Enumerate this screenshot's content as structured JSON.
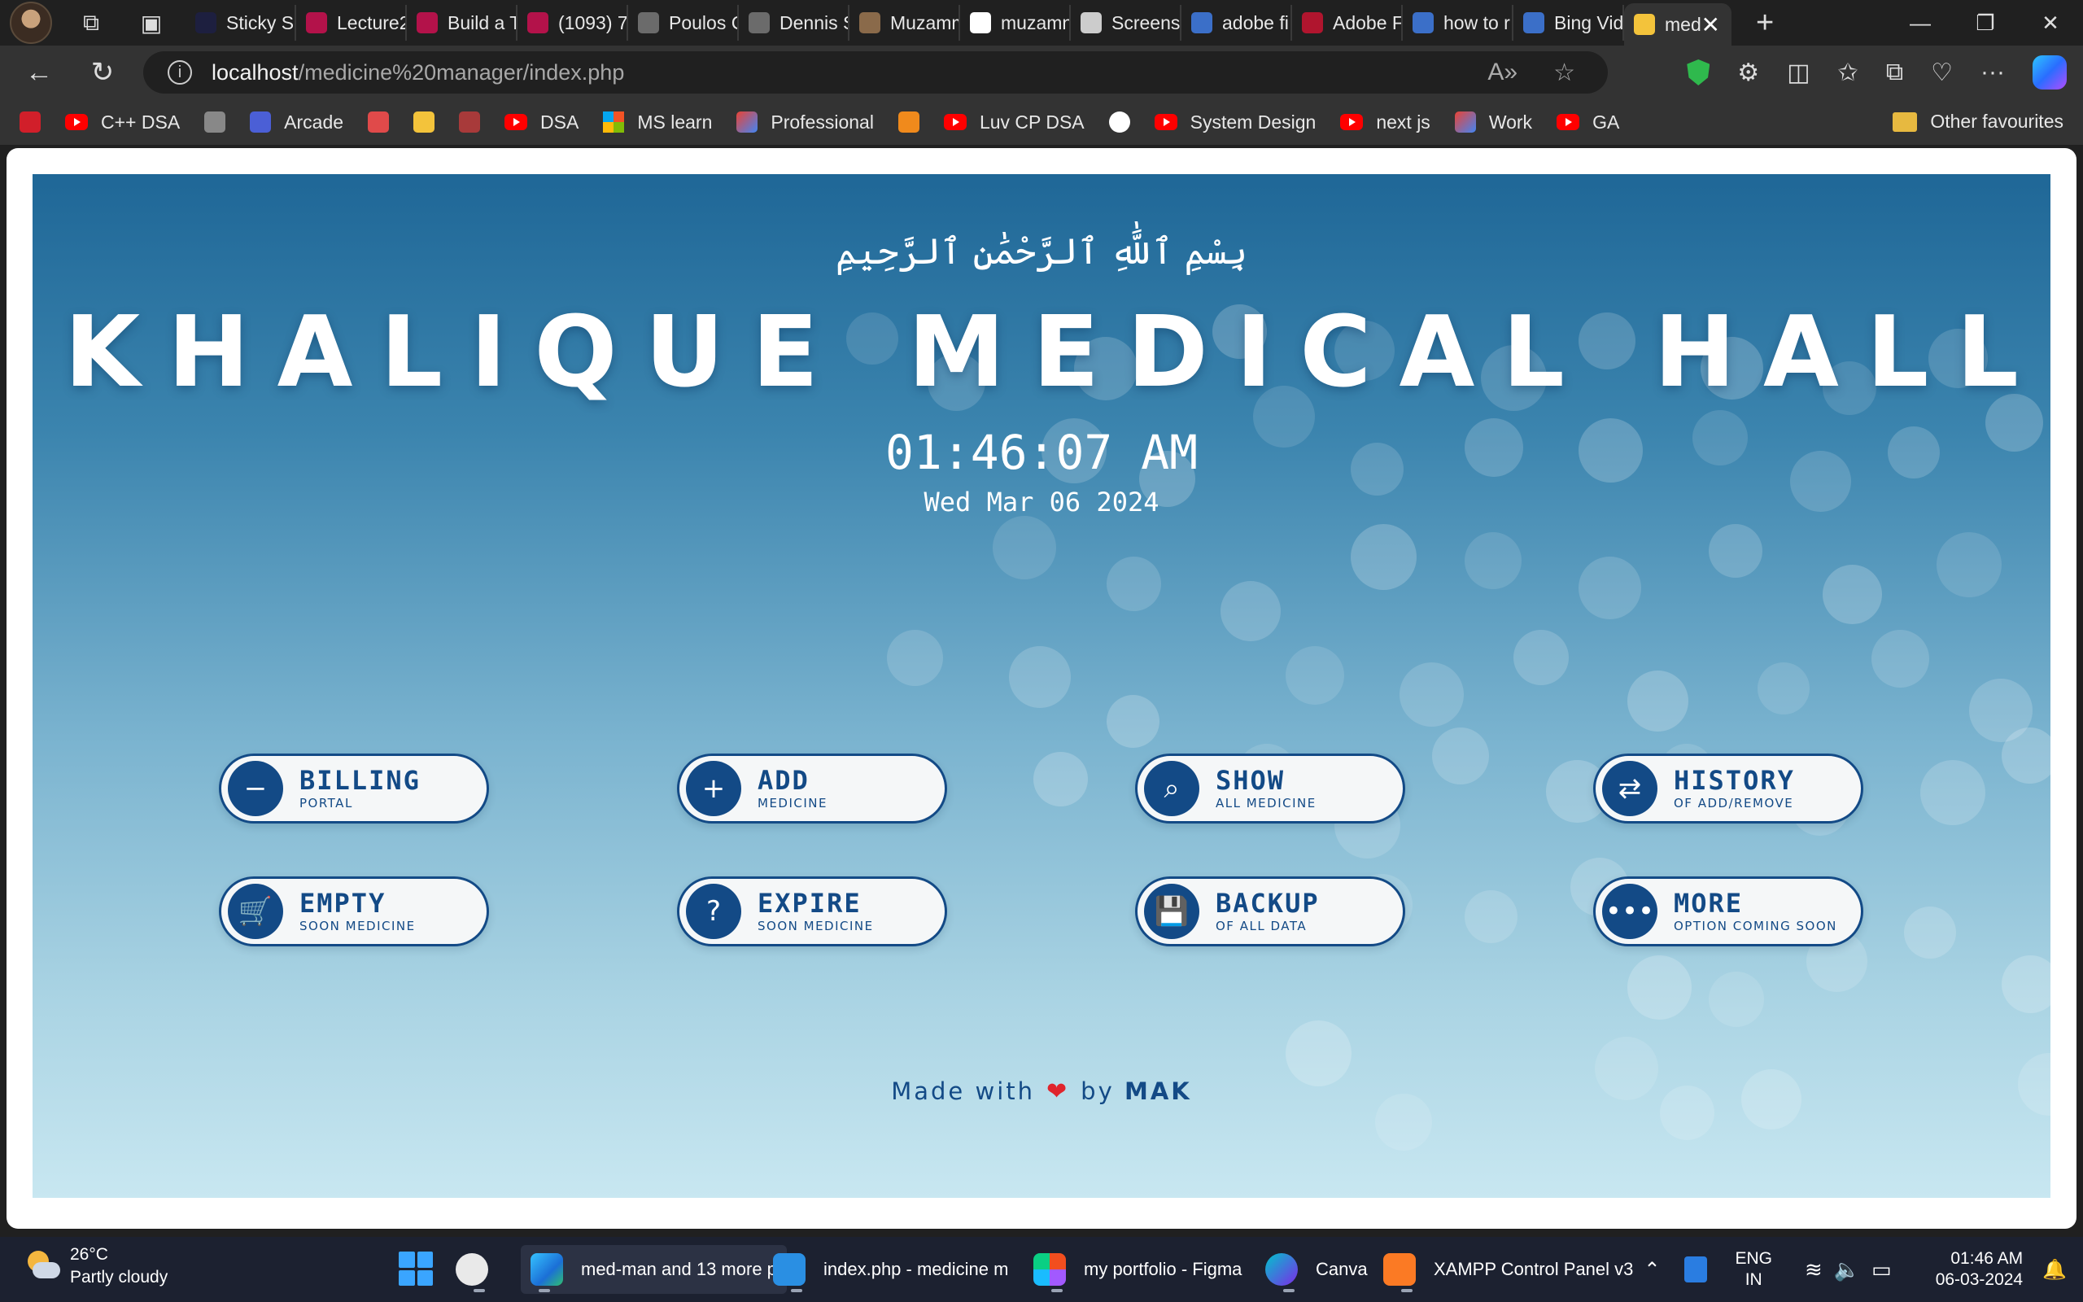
{
  "browser": {
    "tabs": [
      {
        "title": "Sticky Sc",
        "fav_color": "#1d1f3f"
      },
      {
        "title": "Lecture2",
        "fav_color": "#b3124a"
      },
      {
        "title": "Build a T",
        "fav_color": "#b3124a"
      },
      {
        "title": "(1093) 7",
        "fav_color": "#b3124a"
      },
      {
        "title": "Poulos C",
        "fav_color": "#6b6b6b"
      },
      {
        "title": "Dennis S",
        "fav_color": "#6b6b6b"
      },
      {
        "title": "Muzamm",
        "fav_color": "#8a6a4a"
      },
      {
        "title": "muzamn",
        "fav_color": "#ffffff"
      },
      {
        "title": "Screens",
        "fav_color": "#cccccc"
      },
      {
        "title": "adobe fi",
        "fav_color": "#3b6fc8"
      },
      {
        "title": "Adobe F",
        "fav_color": "#b0152e"
      },
      {
        "title": "how to r",
        "fav_color": "#3b6fc8"
      },
      {
        "title": "Bing Vid",
        "fav_color": "#3b6fc8"
      }
    ],
    "active_tab": {
      "title": "med",
      "close": "✕"
    },
    "new_tab": "+",
    "window_controls": {
      "minimize": "—",
      "restore": "❐",
      "close": "✕"
    },
    "back": "←",
    "refresh": "↻",
    "url_host": "localhost",
    "url_path": "/medicine%20manager/index.php",
    "bookmarks": [
      {
        "label": "",
        "kind": "sl"
      },
      {
        "label": "C++ DSA",
        "kind": "yt"
      },
      {
        "label": "",
        "kind": "icon",
        "color": "#888"
      },
      {
        "label": "Arcade",
        "kind": "icon",
        "color": "#4b5fd6"
      },
      {
        "label": "",
        "kind": "icon",
        "color": "#e04a4a"
      },
      {
        "label": "",
        "kind": "icon",
        "color": "#f3c33b"
      },
      {
        "label": "",
        "kind": "icon",
        "color": "#a83a3a"
      },
      {
        "label": "DSA",
        "kind": "yt"
      },
      {
        "label": "MS learn",
        "kind": "ms"
      },
      {
        "label": "Professional",
        "kind": "gmail"
      },
      {
        "label": "",
        "kind": "icon",
        "color": "#f08a1c"
      },
      {
        "label": "Luv CP DSA",
        "kind": "yt"
      },
      {
        "label": "",
        "kind": "gh"
      },
      {
        "label": "System Design",
        "kind": "yt"
      },
      {
        "label": "next js",
        "kind": "yt"
      },
      {
        "label": "Work",
        "kind": "gmail"
      },
      {
        "label": "GA",
        "kind": "yt"
      }
    ],
    "other_favourites": "Other favourites"
  },
  "page": {
    "bismillah": "بِسْمِ ٱللَّٰهِ ٱلرَّحْمَٰنِ ٱلرَّحِيمِ",
    "title": "KHALIQUE MEDICAL HALL",
    "time": "01:46:07 AM",
    "date": "Wed Mar 06 2024",
    "buttons": [
      {
        "label": "BILLING",
        "sub": "PORTAL",
        "icon": "minus-icon",
        "glyph": "−"
      },
      {
        "label": "ADD",
        "sub": "MEDICINE",
        "icon": "plus-icon",
        "glyph": "+"
      },
      {
        "label": "SHOW",
        "sub": "ALL MEDICINE",
        "icon": "search-icon",
        "glyph": "⌕"
      },
      {
        "label": "HISTORY",
        "sub": "OF ADD/REMOVE",
        "icon": "swap-arrows-icon",
        "glyph": "⇄"
      },
      {
        "label": "EMPTY",
        "sub": "SOON MEDICINE",
        "icon": "cart-icon",
        "glyph": "🛒"
      },
      {
        "label": "EXPIRE",
        "sub": "SOON MEDICINE",
        "icon": "question-icon",
        "glyph": "?"
      },
      {
        "label": "BACKUP",
        "sub": "OF ALL DATA",
        "icon": "save-icon",
        "glyph": "💾"
      },
      {
        "label": "MORE",
        "sub": "OPTION COMING SOON",
        "icon": "more-dots-icon",
        "glyph": "•••"
      }
    ],
    "footer": {
      "made_with": "Made with",
      "by": "by",
      "author": "MAK",
      "heart": "❤"
    }
  },
  "taskbar": {
    "weather_temp": "26°C",
    "weather_desc": "Partly cloudy",
    "apps": [
      {
        "label": "",
        "name": "clock"
      },
      {
        "label": "med-man and 13 more p",
        "name": "edge"
      },
      {
        "label": "index.php - medicine m",
        "name": "vscode"
      },
      {
        "label": "my portfolio - Figma",
        "name": "figma"
      },
      {
        "label": "Canva",
        "name": "canva"
      },
      {
        "label": "XAMPP Control Panel v3",
        "name": "xampp"
      }
    ],
    "lang_1": "ENG",
    "lang_2": "IN",
    "time": "01:46 AM",
    "date": "06-03-2024"
  },
  "colors": {
    "brand": "#134a86",
    "heart": "#e0242c"
  }
}
